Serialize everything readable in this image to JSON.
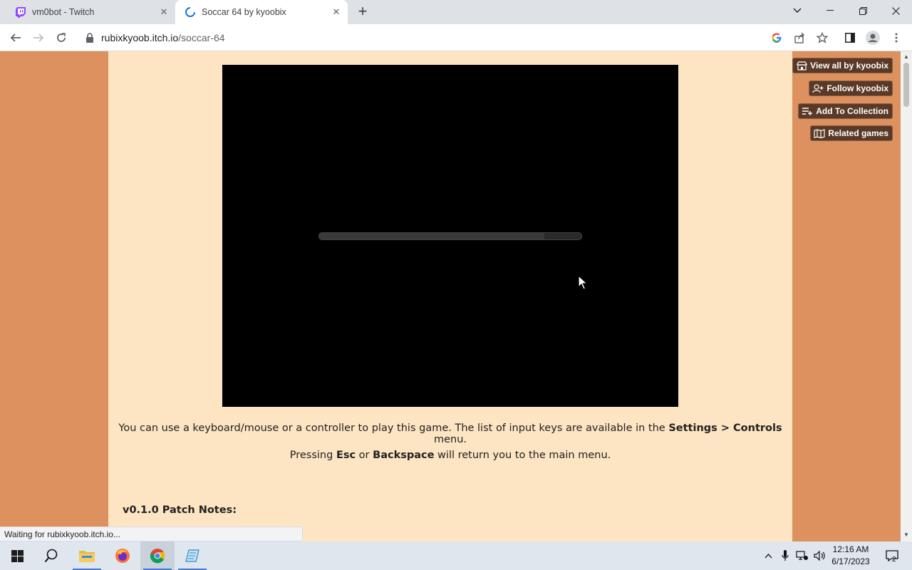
{
  "browser": {
    "tabs": [
      {
        "title": "vm0bot - Twitch",
        "icon": "twitch-icon"
      },
      {
        "title": "Soccar 64 by kyoobix",
        "icon": "loading-spinner-icon"
      }
    ],
    "new_tab_icon": "plus-icon",
    "url_host": "rubixkyoob.itch.io",
    "url_path": "/soccar-64",
    "status": "Waiting for rubixkyoob.itch.io..."
  },
  "game": {
    "loading_progress": 0.86
  },
  "sidebar_buttons": [
    {
      "label": "View all by kyoobix",
      "icon": "itch-store-icon"
    },
    {
      "label": "Follow kyoobix",
      "icon": "add-user-icon"
    },
    {
      "label": "Add To Collection",
      "icon": "add-list-icon"
    },
    {
      "label": "Related games",
      "icon": "map-icon"
    }
  ],
  "description": {
    "line1_part1": "You can use a keyboard/mouse or a controller to play this game.  The list of input keys are available in the ",
    "line1_bold": "Settings > Controls",
    "line1_part2": " menu.",
    "line2_part1": "Pressing ",
    "line2_bold1": "Esc",
    "line2_part2": " or ",
    "line2_bold2": "Backspace",
    "line2_part3": " will return you to the main menu.",
    "patch_title": "v0.1.0 Patch Notes:"
  },
  "taskbar": {
    "time": "12:16 AM",
    "date": "6/17/2023",
    "notification_count": "2"
  },
  "colors": {
    "page_bg": "#dc915f",
    "content_bg": "#fde4c2",
    "button_bg": "#5a3a26"
  }
}
